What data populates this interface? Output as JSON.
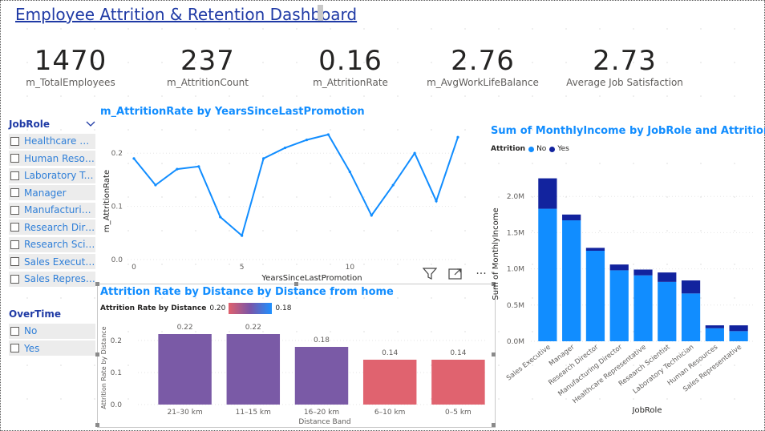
{
  "title": "Employee Attrition & Retention Dashboard",
  "kpis": [
    {
      "value": "1470",
      "label": "m_TotalEmployees"
    },
    {
      "value": "237",
      "label": "m_AttritionCount"
    },
    {
      "value": "0.16",
      "label": "m_AttritionRate"
    },
    {
      "value": "2.76",
      "label": "m_AvgWorkLifeBalance"
    },
    {
      "value": "2.73",
      "label": "Average Job Satisfaction"
    }
  ],
  "slicers": {
    "jobrole": {
      "title": "JobRole",
      "items": [
        "Healthcare Re...",
        "Human Resour...",
        "Laboratory Tec...",
        "Manager",
        "Manufacturing...",
        "Research Direc...",
        "Research Scien...",
        "Sales Executive",
        "Sales Represen..."
      ]
    },
    "overtime": {
      "title": "OverTime",
      "items": [
        "No",
        "Yes"
      ]
    }
  },
  "toolbar": {
    "icons": [
      "filter-icon",
      "focus-mode-icon",
      "more-options-icon"
    ],
    "more_label": "···"
  },
  "line_chart": {
    "title": "m_AttritionRate by YearsSinceLastPromotion",
    "chart_data": {
      "type": "line",
      "x": [
        0,
        1,
        2,
        3,
        4,
        5,
        6,
        7,
        8,
        9,
        10,
        11,
        12,
        13,
        14,
        15
      ],
      "y": [
        0.19,
        0.14,
        0.17,
        0.175,
        0.08,
        0.045,
        0.19,
        0.21,
        0.225,
        0.235,
        0.165,
        0.083,
        0.14,
        0.2,
        0.11,
        0.23
      ],
      "xlabel": "YearsSinceLastPromotion",
      "ylabel": "m_AttritionRate",
      "xticks": [
        "0",
        "5",
        "10"
      ],
      "yticks": [
        "0.0",
        "0.1",
        "0.2"
      ],
      "xlim": [
        0,
        15
      ],
      "ylim": [
        0,
        0.25
      ],
      "color": "#118dff"
    }
  },
  "bar_chart": {
    "title": "Attrition Rate by Distance by Distance from home",
    "legend_title": "Attrition Rate by Distance",
    "legend_min": "0.20",
    "legend_max": "0.18",
    "chart_data": {
      "type": "bar",
      "categories": [
        "21–30 km",
        "11–15 km",
        "16–20 km",
        "6–10 km",
        "0–5 km"
      ],
      "values": [
        0.22,
        0.22,
        0.18,
        0.14,
        0.14
      ],
      "labels": [
        "0.22",
        "0.22",
        "0.18",
        "0.14",
        "0.14"
      ],
      "colors": [
        "#7a5aa6",
        "#7a5aa6",
        "#7a5aa6",
        "#e0636f",
        "#e0636f"
      ],
      "xlabel": "Distance Band",
      "ylabel": "Attrition Rate by Distance",
      "yticks": [
        "0.0",
        "0.1",
        "0.2"
      ],
      "ylim": [
        0,
        0.25
      ]
    }
  },
  "stacked_chart": {
    "title": "Sum of MonthlyIncome by JobRole and Attrition",
    "legend_title": "Attrition",
    "chart_data": {
      "type": "bar",
      "stacked": true,
      "categories": [
        "Sales Executive",
        "Manager",
        "Research Director",
        "Manufacturing Director",
        "Healthcare Representative",
        "Research Scientist",
        "Laboratory Technician",
        "Human Resources",
        "Sales Representative"
      ],
      "series": [
        {
          "name": "No",
          "color": "#118dff",
          "values": [
            1830000,
            1670000,
            1250000,
            980000,
            910000,
            820000,
            660000,
            180000,
            140000
          ]
        },
        {
          "name": "Yes",
          "color": "#12239e",
          "values": [
            420000,
            80000,
            40000,
            80000,
            80000,
            130000,
            180000,
            40000,
            80000
          ]
        }
      ],
      "xlabel": "JobRole",
      "ylabel": "Sum of MonthlyIncome",
      "yticks": [
        "0.0M",
        "0.5M",
        "1.0M",
        "1.5M",
        "2.0M"
      ],
      "ylim": [
        0,
        2500000
      ]
    }
  }
}
